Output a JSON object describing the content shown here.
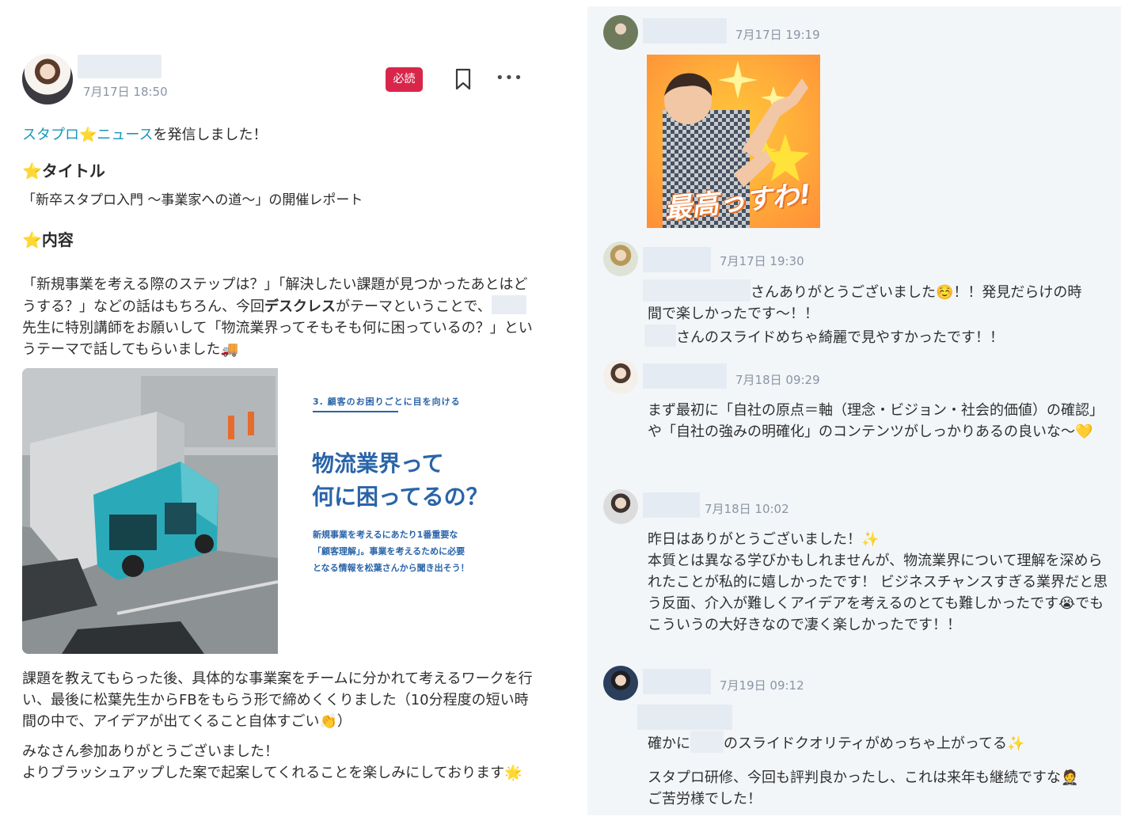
{
  "post": {
    "time": "7月17日 18:50",
    "badge": "必読",
    "more_icon": "•••",
    "line1_link1": "スタプロ",
    "line1_star": "⭐",
    "line1_link2": "ニュース",
    "line1_rest": "を発信しました！",
    "title_heading": "タイトル",
    "title_text": "「新卒スタプロ入門 〜事業家への道〜」の開催レポート",
    "content_heading": "内容",
    "star": "⭐",
    "p1_a": "「新規事業を考える際のステップは？」「解決したい課題が見つかったあとはどうする？」などの話はもちろん、今回",
    "p1_bold": "デスクレス",
    "p1_b": "がテーマということで、",
    "p1_c": "先生に特別講師をお願いして「物流業界ってそもそも何に困っているの？」というテーマで話してもらいました",
    "p1_emoji": "🚚",
    "p2": "課題を教えてもらった後、具体的な事業案をチームに分かれて考えるワークを行い、最後に松葉先生からFBをもらう形で締めくくりました（10分程度の短い時間の中で、アイデアが出てくること自体すごい",
    "p2_emoji": "👏",
    "p2_end": "）",
    "p3_line1": "みなさん参加ありがとうございました！",
    "p3_line2": "よりブラッシュアップした案で起案してくれることを楽しみにしております",
    "p3_emoji": "🌟"
  },
  "slide": {
    "label": "3. 顧客のお困りごとに目を向ける",
    "head_line1": "物流業界って",
    "head_line2": "何に困ってるの？",
    "body_line1": "新規事業を考えるにあたり1番重要な",
    "body_line2": "「顧客理解」。事業を考えるために必要",
    "body_line3": "となる情報を松葉さんから聞き出そう！"
  },
  "thread": {
    "comments": [
      {
        "time": "7月17日 19:19",
        "stamp_text": "最高っすわ!"
      },
      {
        "time": "7月17日 19:30",
        "text_line1_after": "さんありがとうございました",
        "emoji1": "☺️",
        "text_line1_end": "！！発見だらけの時",
        "text_line2": "間で楽しかったです〜！！",
        "text_line3_after": "さんのスライドめちゃ綺麗で見やすかったです！！"
      },
      {
        "time": "7月18日 09:29",
        "text": "まず最初に「自社の原点＝軸（理念・ビジョン・社会的価値）の確認」や「自社の強みの明確化」のコンテンツがしっかりあるの良いな〜",
        "emoji": "💛"
      },
      {
        "time": "7月18日 10:02",
        "line1": "昨日はありがとうございました！",
        "emoji1": "✨",
        "para": "本質とは異なる学びかもしれませんが、物流業界について理解を深められたことが私的に嬉しかったです！ ビジネスチャンスすぎる業界だと思う反面、介入が難しくアイデアを考えるのとても難しかったです",
        "emoji2": "😭",
        "para_end": "でもこういうの大好きなので凄く楽しかったです！！"
      },
      {
        "time": "7月19日 09:12",
        "line1_a": "確かに",
        "line1_b": "のスライドクオリティがめっちゃ上がってる",
        "emoji1": "✨",
        "line2": "スタプロ研修、今回も評判良かったし、これは来年も継続ですな",
        "emoji2": "🤵",
        "line3": "ご苦労様でした！"
      }
    ]
  },
  "colors": {
    "link": "#1a97b8",
    "badge": "#d8264a",
    "slide_blue": "#2a64a8",
    "thread_bg": "#f3f6f9"
  }
}
